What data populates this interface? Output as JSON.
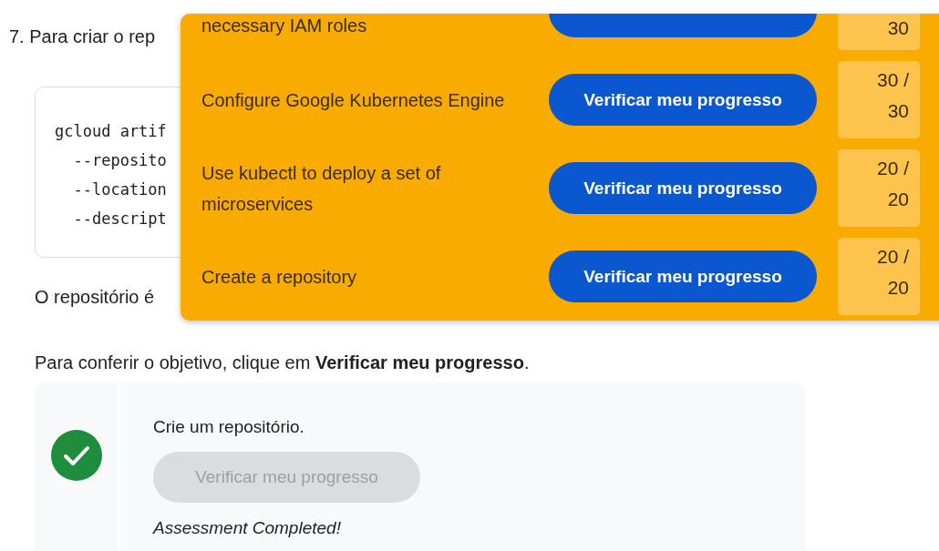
{
  "step": "7. Para criar o rep",
  "code_lines": [
    "gcloud artif",
    "  --reposito",
    "  --location",
    "  --descript"
  ],
  "note": "O repositório é",
  "instruction": "Para conferir o objetivo, clique em **Verificar meu progresso**.",
  "check": {
    "task": "Crie um repositório.",
    "button": "Verificar meu progresso",
    "disabled": true,
    "completed": true,
    "status": "Assessment Completed!"
  },
  "progress_panel": {
    "items": [
      {
        "label": "necessary IAM roles",
        "score": "30"
      },
      {
        "label": "Configure Google Kubernetes Engine",
        "button": "Verificar meu progresso",
        "score": "30 / 30"
      },
      {
        "label": "Use kubectl to deploy a set of microservices",
        "button": "Verificar meu progresso",
        "score": "20 / 20"
      },
      {
        "label": "Create a repository",
        "button": "Verificar meu progresso",
        "score": "20 / 20"
      }
    ]
  }
}
